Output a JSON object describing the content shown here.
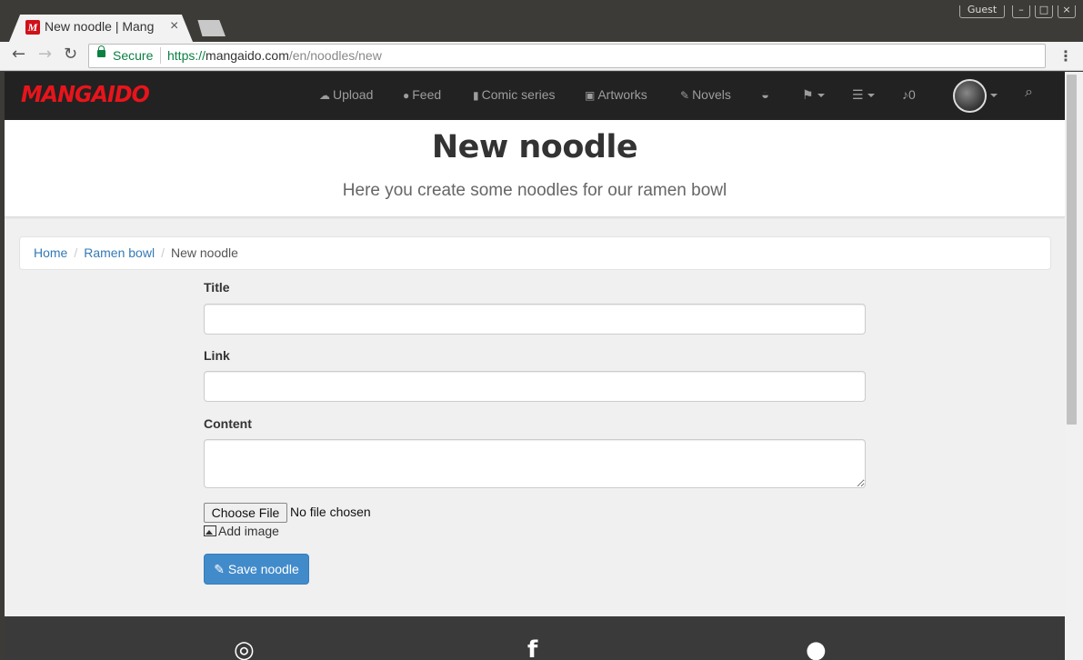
{
  "browser": {
    "tab_title": "New noodle | Mang",
    "tab_favicon": "M",
    "tab_close": "×",
    "profile": "Guest",
    "window_controls": [
      "–",
      "□",
      "×"
    ],
    "secure_label": "Secure",
    "url_scheme": "https://",
    "url_host": "mangaido.com",
    "url_path": "/en/noodles/new",
    "menu": "⋮"
  },
  "navbar": {
    "logo": "MANGAIDO",
    "items": [
      {
        "label": "Upload",
        "icon": "☁"
      },
      {
        "label": "Feed",
        "icon": "💬"
      },
      {
        "label": "Comic series",
        "icon": "▮"
      },
      {
        "label": "Artworks",
        "icon": "▣"
      },
      {
        "label": "Novels",
        "icon": "✎"
      }
    ],
    "notifications": "0",
    "bowl_icon": "bowl-icon",
    "flag_icon": "flag-icon",
    "menu_icon": "☰",
    "bell_icon": "🔔",
    "search_icon": "⌕"
  },
  "header": {
    "title": "New noodle",
    "subtitle": "Here you create some noodles for our ramen bowl"
  },
  "breadcrumb": {
    "home": "Home",
    "ramen": "Ramen bowl",
    "current": "New noodle",
    "divider": "/"
  },
  "form": {
    "title_label": "Title",
    "link_label": "Link",
    "content_label": "Content",
    "file_button": "Choose File",
    "file_status": "No file chosen",
    "add_image": "Add image",
    "save": "Save noodle"
  }
}
